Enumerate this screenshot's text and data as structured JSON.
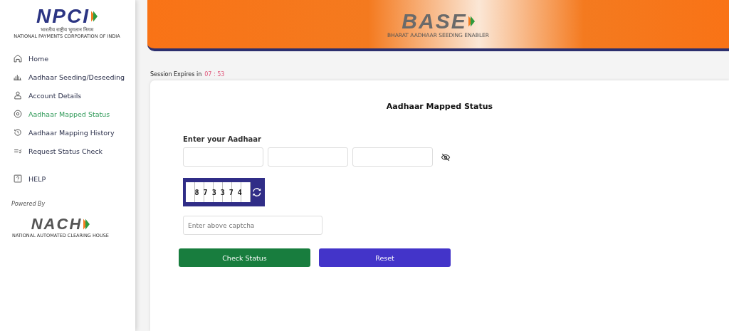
{
  "sidebar": {
    "logo": {
      "wordmark": "NPCI",
      "hindi": "भारतीय राष्ट्रीय भुगतान निगम",
      "tagline": "NATIONAL PAYMENTS CORPORATION OF INDIA"
    },
    "items": [
      {
        "kind": "home",
        "label": "Home",
        "selected": false
      },
      {
        "kind": "seeding",
        "label": "Aadhaar Seeding/Deseeding",
        "selected": false
      },
      {
        "kind": "account",
        "label": "Account Details",
        "selected": false
      },
      {
        "kind": "status",
        "label": "Aadhaar Mapped Status",
        "selected": true
      },
      {
        "kind": "history",
        "label": "Aadhaar Mapping History",
        "selected": false
      },
      {
        "kind": "request",
        "label": "Request Status Check",
        "selected": false
      },
      {
        "kind": "help",
        "label": "HELP",
        "selected": false
      }
    ],
    "powered_by": "Powered By",
    "partner_logo": {
      "wordmark": "NACH",
      "tagline": "NATIONAL AUTOMATED CLEARING HOUSE"
    }
  },
  "header": {
    "wordmark": "BASE",
    "tagline": "BHARAT AADHAAR SEEDING ENABLER"
  },
  "session": {
    "label": "Session Expires in",
    "time": "07 : 53"
  },
  "form": {
    "title": "Aadhaar Mapped Status",
    "aadhaar_label": "Enter your Aadhaar",
    "captcha": "8 7 3 3 7 4",
    "captcha_placeholder": "Enter above captcha",
    "buttons": [
      {
        "kind": "primary",
        "label": "Check Status"
      },
      {
        "kind": "secondary",
        "label": "Reset"
      }
    ]
  }
}
